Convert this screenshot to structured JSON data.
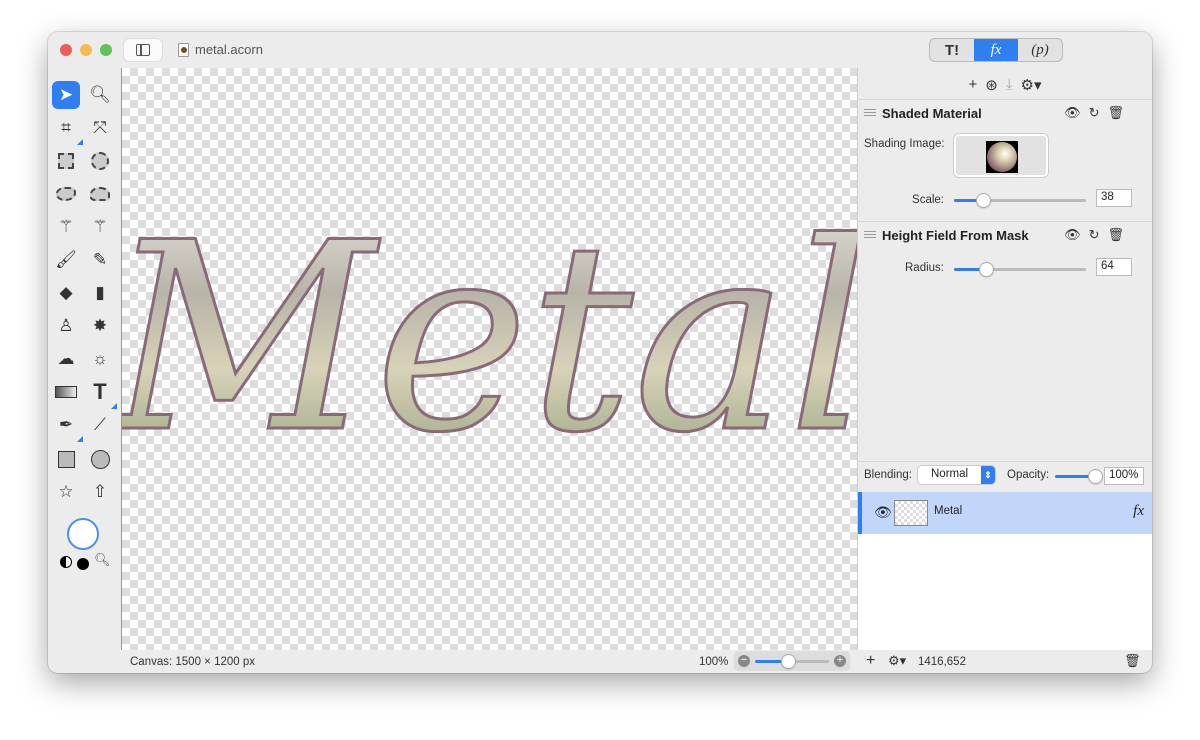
{
  "window": {
    "title": "metal.acorn",
    "traffic_lights": [
      "#ee5c56",
      "#f5bd4f",
      "#5fc454"
    ]
  },
  "inspector_tabs": [
    {
      "label": "T!",
      "icon": "tools-icon"
    },
    {
      "label": "fx",
      "active": true
    },
    {
      "label": "(p)"
    }
  ],
  "filters_toolbar": {
    "add": "+",
    "icons": [
      "add-filter-icon",
      "filter-presets-icon",
      "download-icon",
      "gear-menu-icon"
    ]
  },
  "filters": [
    {
      "name": "Shaded Material",
      "shading_label": "Shading Image:",
      "param_label": "Scale:",
      "value": "38",
      "slider_fraction": 0.22
    },
    {
      "name": "Height Field From Mask",
      "param_label": "Radius:",
      "value": "64",
      "slider_fraction": 0.24
    }
  ],
  "blending": {
    "label": "Blending:",
    "mode": "Normal",
    "opacity_label": "Opacity:",
    "opacity": "100%",
    "opacity_fraction": 1.0
  },
  "layers": [
    {
      "name": "Metal",
      "fx": "fx",
      "selected": true
    }
  ],
  "canvas": {
    "text": "Metal"
  },
  "status": {
    "canvas_size": "Canvas: 1500 × 1200 px",
    "zoom": "100%",
    "zoom_fraction": 0.45,
    "layer_add": "+",
    "coords": "1416,652"
  },
  "colors": {
    "accent": "#2f7ff0",
    "selection": "#c2d6fa"
  }
}
